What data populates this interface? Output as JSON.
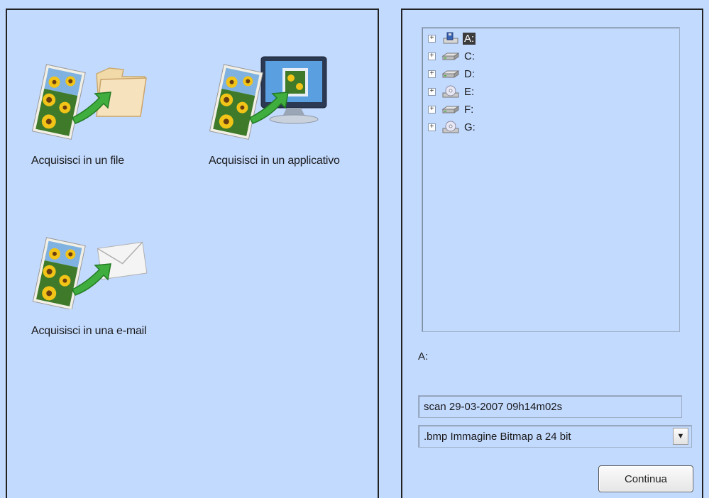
{
  "actions": [
    {
      "label": "Acquisisci in un file",
      "icon": "scan-to-file-icon"
    },
    {
      "label": "Acquisisci in un applicativo",
      "icon": "scan-to-application-icon"
    },
    {
      "label": "Acquisisci in una e-mail",
      "icon": "scan-to-email-icon"
    }
  ],
  "tree": {
    "items": [
      {
        "label": "A:",
        "icon": "floppy-drive-icon",
        "selected": true
      },
      {
        "label": "C:",
        "icon": "hard-drive-icon",
        "selected": false
      },
      {
        "label": "D:",
        "icon": "hard-drive-icon",
        "selected": false
      },
      {
        "label": "E:",
        "icon": "cd-drive-icon",
        "selected": false
      },
      {
        "label": "F:",
        "icon": "hard-drive-icon",
        "selected": false
      },
      {
        "label": "G:",
        "icon": "cd-drive-icon",
        "selected": false
      }
    ],
    "expander_symbol": "+"
  },
  "current_path": "A:",
  "filename": {
    "value": "scan 29-03-2007 09h14m02s"
  },
  "format": {
    "selected": ".bmp Immagine Bitmap a 24 bit",
    "arrow_symbol": "▼"
  },
  "continue_label": "Continua",
  "colors": {
    "background": "#c3daff",
    "selection": "#3b3b3b",
    "arrow_green": "#3fae3f"
  }
}
